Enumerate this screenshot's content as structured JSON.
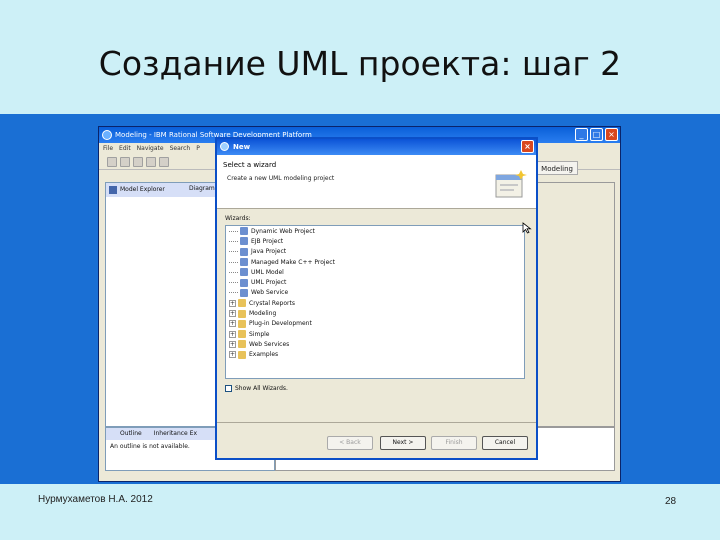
{
  "slide": {
    "title": "Создание UML проекта: шаг 2",
    "author": "Нурмухаметов Н.А. 2012",
    "page_number": "28"
  },
  "eclipse": {
    "window_title": "Modeling - IBM Rational Software Development Platform",
    "menu": [
      "File",
      "Edit",
      "Navigate",
      "Search",
      "P"
    ],
    "perspective": "Modeling",
    "explorer_tab": "Model Explorer",
    "diagram_tab": "Diagram",
    "outline_tab": "Outline",
    "inheritance_tab": "Inheritance Ex",
    "outline_message": "An outline is not available."
  },
  "dialog": {
    "title": "New",
    "heading": "Select a wizard",
    "description": "Create a new UML modeling project",
    "wizards_label": "Wizards:",
    "wizards": [
      {
        "label": "Dynamic Web Project",
        "kind": "project",
        "expander": ""
      },
      {
        "label": "EJB Project",
        "kind": "project",
        "expander": ""
      },
      {
        "label": "Java Project",
        "kind": "project",
        "expander": ""
      },
      {
        "label": "Managed Make C++ Project",
        "kind": "project",
        "expander": ""
      },
      {
        "label": "UML Model",
        "kind": "project",
        "expander": ""
      },
      {
        "label": "UML Project",
        "kind": "project",
        "expander": ""
      },
      {
        "label": "Web Service",
        "kind": "project",
        "expander": ""
      },
      {
        "label": "Crystal Reports",
        "kind": "folder",
        "expander": "+"
      },
      {
        "label": "Modeling",
        "kind": "folder",
        "expander": "+"
      },
      {
        "label": "Plug-in Development",
        "kind": "folder",
        "expander": "+"
      },
      {
        "label": "Simple",
        "kind": "folder",
        "expander": "+"
      },
      {
        "label": "Web Services",
        "kind": "folder",
        "expander": "+"
      },
      {
        "label": "Examples",
        "kind": "folder",
        "expander": "+"
      }
    ],
    "show_all_label": "Show All Wizards.",
    "buttons": {
      "back": "< Back",
      "next": "Next >",
      "finish": "Finish",
      "cancel": "Cancel"
    }
  },
  "colors": {
    "slide_background": "#cdf0f7",
    "panel_blue": "#1a6fd4",
    "titlebar_blue": "#0b53d6"
  }
}
